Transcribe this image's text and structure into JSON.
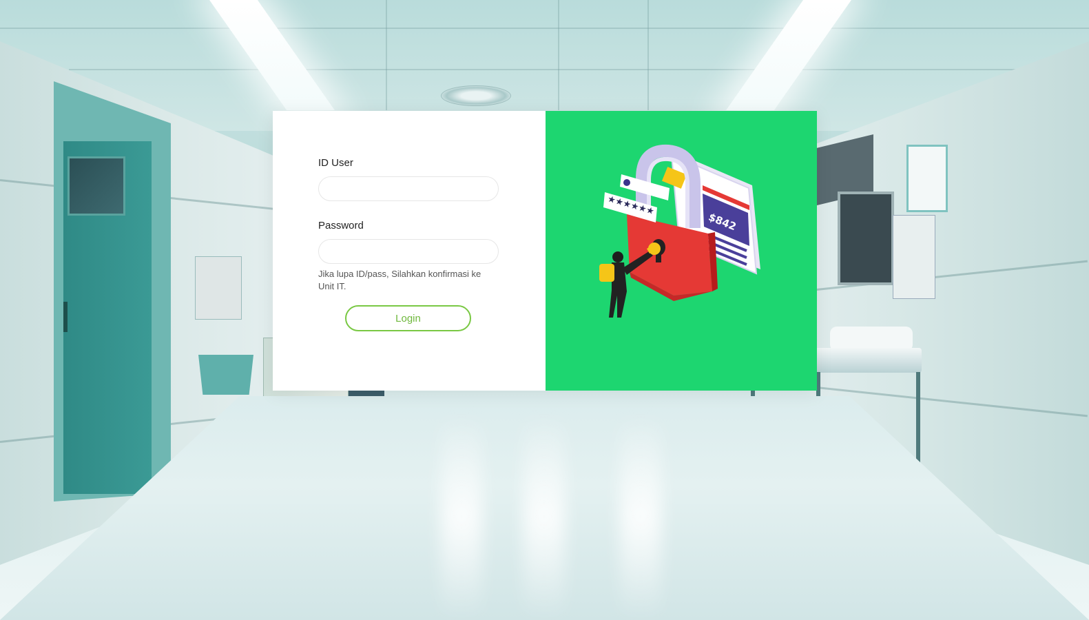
{
  "login": {
    "user_label": "ID User",
    "user_value": "",
    "password_label": "Password",
    "password_value": "",
    "hint": "Jika lupa ID/pass, Silahkan konfirmasi ke Unit IT.",
    "login_button": "Login"
  },
  "illustration": {
    "price_text": "$842",
    "masked_password": "★★★★★★",
    "icon": "padlock-security-icon"
  },
  "colors": {
    "panel_green": "#1dd670",
    "button_border": "#79c843",
    "button_text": "#6fb83d",
    "lock_red": "#e53935",
    "key_yellow": "#f5c518"
  }
}
